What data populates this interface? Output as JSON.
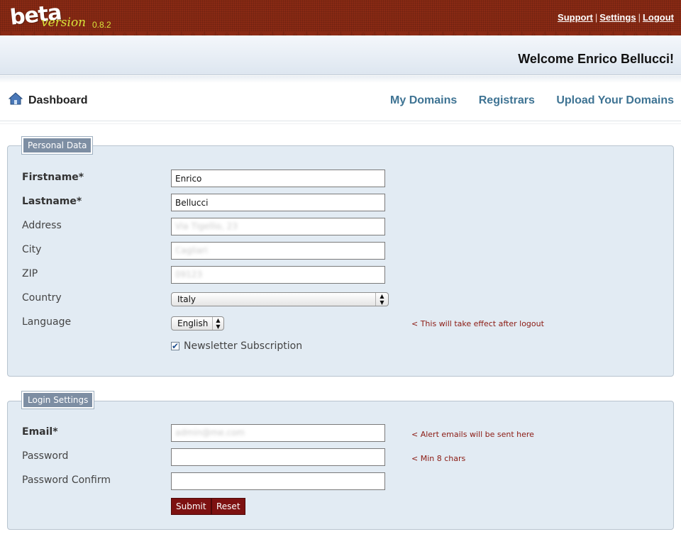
{
  "app": {
    "logo_text": "beta",
    "logo_version_word": "version",
    "version_number": "0.8.2",
    "brand_color": "#8a2a14",
    "accent_color": "#d7e33a"
  },
  "top_links": {
    "support": "Support",
    "settings": "Settings",
    "logout": "Logout",
    "separator": "|"
  },
  "welcome": "Welcome Enrico Bellucci!",
  "nav": {
    "dashboard": "Dashboard",
    "dashboard_icon": "home-icon",
    "links": [
      "My Domains",
      "Registrars",
      "Upload Your Domains"
    ],
    "link_color": "#3e7393"
  },
  "personal": {
    "legend": "Personal Data",
    "firstname_label": "Firstname*",
    "firstname_value": "Enrico",
    "lastname_label": "Lastname*",
    "lastname_value": "Bellucci",
    "address_label": "Address",
    "address_value": "Via Tigellio, 23",
    "city_label": "City",
    "city_value": "Cagliari",
    "zip_label": "ZIP",
    "zip_value": "09123",
    "country_label": "Country",
    "country_value": "Italy",
    "language_label": "Language",
    "language_value": "English",
    "language_hint": "< This will take effect after logout",
    "newsletter_label": "Newsletter Subscription",
    "newsletter_checked": true
  },
  "login": {
    "legend": "Login Settings",
    "email_label": "Email*",
    "email_value": "admin@me.com",
    "email_hint": "< Alert emails will be sent here",
    "password_label": "Password",
    "password_hint": "< Min 8 chars",
    "password_confirm_label": "Password Confirm",
    "submit": "Submit",
    "reset": "Reset"
  },
  "hint_color": "#8b1a12"
}
